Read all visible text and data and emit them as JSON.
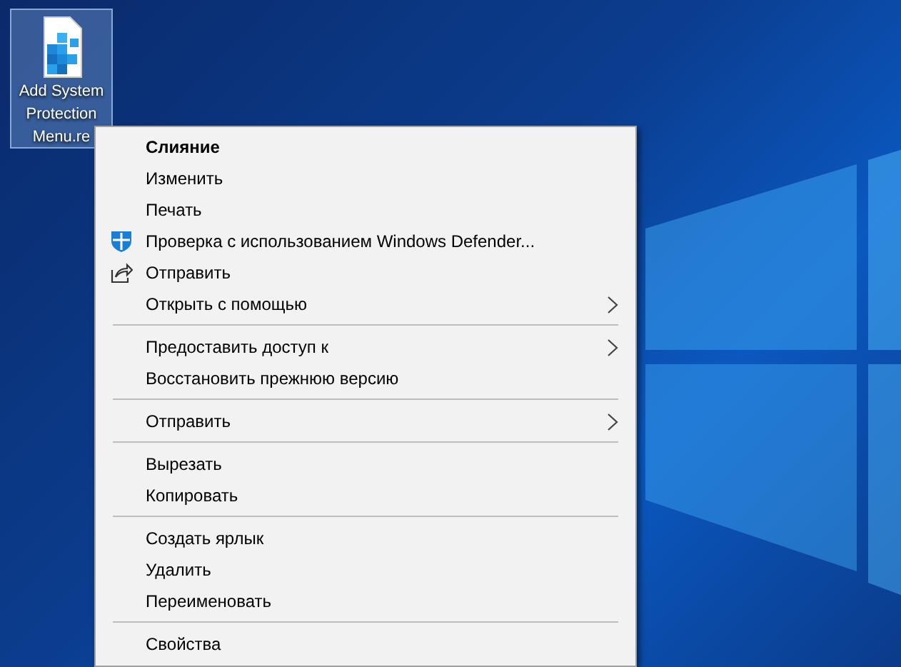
{
  "desktop_icon": {
    "label_lines": [
      "Add System",
      "Protection",
      "Menu.re"
    ],
    "selected": true
  },
  "context_menu": {
    "groups": [
      [
        {
          "label": "Слияние",
          "bold": true,
          "kind": "plain",
          "submenu": false
        },
        {
          "label": "Изменить",
          "bold": false,
          "kind": "plain",
          "submenu": false
        },
        {
          "label": "Печать",
          "bold": false,
          "kind": "plain",
          "submenu": false
        },
        {
          "label": "Проверка с использованием Windows Defender...",
          "bold": false,
          "kind": "shield",
          "submenu": false
        },
        {
          "label": "Отправить",
          "bold": false,
          "kind": "share",
          "submenu": false
        },
        {
          "label": "Открыть с помощью",
          "bold": false,
          "kind": "plain",
          "submenu": true
        }
      ],
      [
        {
          "label": "Предоставить доступ к",
          "bold": false,
          "kind": "plain",
          "submenu": true
        },
        {
          "label": "Восстановить прежнюю версию",
          "bold": false,
          "kind": "plain",
          "submenu": false
        }
      ],
      [
        {
          "label": "Отправить",
          "bold": false,
          "kind": "plain",
          "submenu": true
        }
      ],
      [
        {
          "label": "Вырезать",
          "bold": false,
          "kind": "plain",
          "submenu": false
        },
        {
          "label": "Копировать",
          "bold": false,
          "kind": "plain",
          "submenu": false
        }
      ],
      [
        {
          "label": "Создать ярлык",
          "bold": false,
          "kind": "plain",
          "submenu": false
        },
        {
          "label": "Удалить",
          "bold": false,
          "kind": "plain",
          "submenu": false
        },
        {
          "label": "Переименовать",
          "bold": false,
          "kind": "plain",
          "submenu": false
        }
      ],
      [
        {
          "label": "Свойства",
          "bold": false,
          "kind": "plain",
          "submenu": false
        }
      ]
    ]
  }
}
